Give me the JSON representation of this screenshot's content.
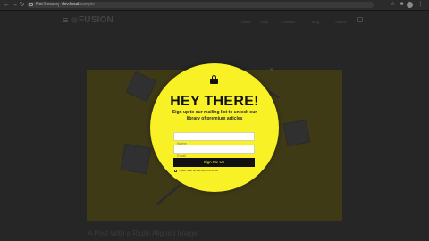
{
  "browser": {
    "back_icon": "arrow-left-icon",
    "forward_icon": "arrow-right-icon",
    "reload_icon": "reload-icon",
    "security_label": "Not Secure",
    "url_host": "dev.local",
    "url_path": "/sample",
    "extensions_icon": "puzzle-icon",
    "star_icon": "star-icon",
    "menu_icon": "more-vertical-icon"
  },
  "site": {
    "logo_text": "FUSION",
    "menu_items": [
      "Home",
      "Shop",
      "Contact",
      "Blog",
      "Submit"
    ],
    "post_title": "A Post With a Right-Aligned Image"
  },
  "popup": {
    "heading": "HEY THERE!",
    "description": "Sign up to our mailing list to unlock our library of premium articles",
    "name_placeholder": "Name",
    "email_placeholder": "Email",
    "button_label": "Sign Me Up",
    "consent_text": "I have read and accept the terms"
  },
  "colors": {
    "popup_bg": "#f7f126",
    "page_overlay": "#262626",
    "button_bg": "#111111"
  }
}
